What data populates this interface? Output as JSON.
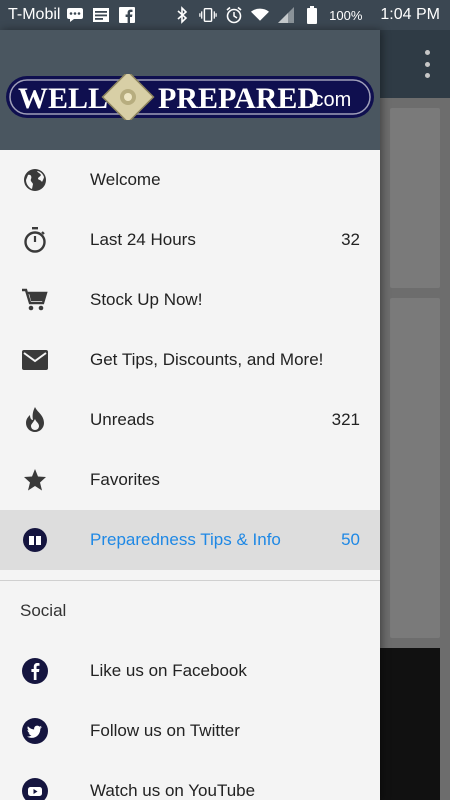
{
  "status_bar": {
    "carrier": "T-Mobil",
    "battery_percent": "100%",
    "time": "1:04 PM"
  },
  "brand": {
    "logo_text_left": "WELL",
    "logo_text_right": "PREPARED",
    "logo_suffix": ".com"
  },
  "menu": {
    "items": [
      {
        "label": "Welcome",
        "count": "",
        "icon": "globe-icon"
      },
      {
        "label": "Last 24 Hours",
        "count": "32",
        "icon": "stopwatch-icon"
      },
      {
        "label": "Stock Up Now!",
        "count": "",
        "icon": "cart-icon"
      },
      {
        "label": "Get Tips, Discounts, and More!",
        "count": "",
        "icon": "mail-icon"
      },
      {
        "label": "Unreads",
        "count": "321",
        "icon": "flame-icon"
      },
      {
        "label": "Favorites",
        "count": "",
        "icon": "star-icon"
      },
      {
        "label": "Preparedness Tips & Info",
        "count": "50",
        "icon": "book-icon",
        "active": true
      }
    ]
  },
  "social": {
    "header": "Social",
    "items": [
      {
        "label": "Like us on Facebook",
        "icon": "facebook-icon"
      },
      {
        "label": "Follow us on Twitter",
        "icon": "twitter-icon"
      },
      {
        "label": "Watch us on YouTube",
        "icon": "youtube-icon"
      }
    ]
  },
  "colors": {
    "active_accent": "#1e88e5",
    "header_bg": "#4a5660",
    "logo_navy": "#0f0f4f"
  }
}
